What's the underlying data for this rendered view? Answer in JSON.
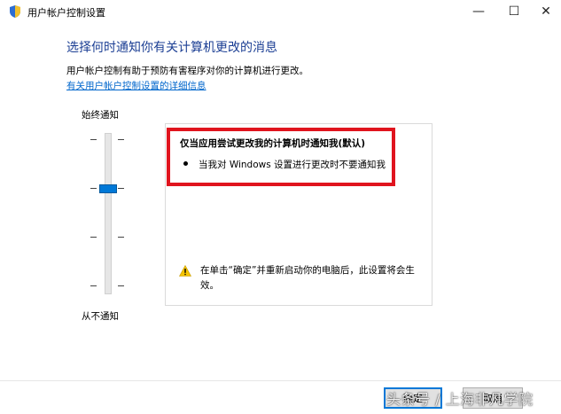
{
  "window": {
    "title": "用户帐户控制设置",
    "icon": "uac-shield-icon",
    "controls": {
      "minimize": "—",
      "maximize": "☐",
      "close": "✕"
    }
  },
  "main": {
    "heading": "选择何时通知你有关计算机更改的消息",
    "description": "用户帐户控制有助于预防有害程序对你的计算机进行更改。",
    "link": "有关用户帐户控制设置的详细信息"
  },
  "slider": {
    "top_label": "始终通知",
    "bottom_label": "从不通知",
    "levels": 4,
    "selected_level": 3
  },
  "info": {
    "level_title": "仅当应用尝试更改我的计算机时通知我(默认)",
    "bullets": [
      "当我对 Windows 设置进行更改时不要通知我"
    ],
    "warning": "在单击“确定”并重新启动你的电脑后，此设置将会生效。"
  },
  "buttons": {
    "ok": "确定",
    "cancel": "取消"
  },
  "watermark": "头条号 / 上海非凡学院",
  "colors": {
    "accent": "#0078d7",
    "heading": "#1c3f94",
    "highlight": "#e0141e",
    "link": "#0066cc"
  }
}
